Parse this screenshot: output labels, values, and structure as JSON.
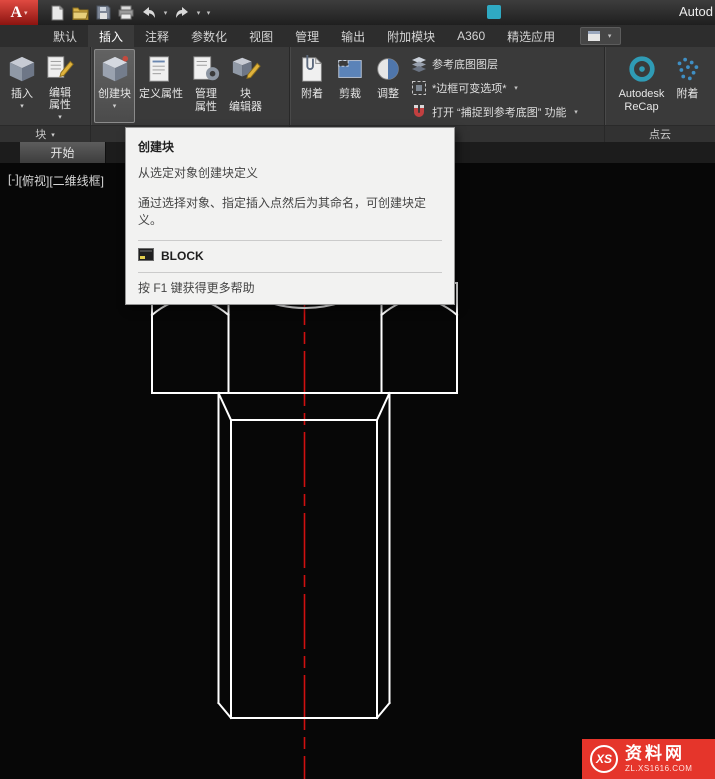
{
  "icons": {
    "caret_down": "▾"
  },
  "titlebar": {
    "logo_letter": "A",
    "window_title": "Autod"
  },
  "tab_bar": {
    "tabs": [
      {
        "label": "默认"
      },
      {
        "label": "插入"
      },
      {
        "label": "注释"
      },
      {
        "label": "参数化"
      },
      {
        "label": "视图"
      },
      {
        "label": "管理"
      },
      {
        "label": "输出"
      },
      {
        "label": "附加模块"
      },
      {
        "label": "A360"
      },
      {
        "label": "精选应用"
      }
    ]
  },
  "ribbon": {
    "block_panel": {
      "label": "块",
      "insert": "插入",
      "edit_attributes": "编辑\n属性"
    },
    "blockdef_panel": {
      "create_block": "创建块",
      "define_attributes": "定义属性",
      "manage_attributes": "管理\n属性",
      "block_editor": "块\n编辑器"
    },
    "reference_panel": {
      "attach": "附着",
      "clip": "剪裁",
      "adjust": "调整",
      "underlay_layers": "参考底图图层",
      "frame_options": "*边框可变选项*",
      "snap_option": "打开 “捕捉到参考底图” 功能"
    },
    "pointcloud_panel": {
      "label": "点云",
      "recap": "Autodesk\nReCap",
      "attach": "附着"
    }
  },
  "file_tab": {
    "label": "开始"
  },
  "tooltip": {
    "title": "创建块",
    "summary": "从选定对象创建块定义",
    "description": "通过选择对象、指定插入点然后为其命名，可创建块定义。",
    "command": "BLOCK",
    "help": "按 F1 键获得更多帮助"
  },
  "viewport": {
    "controls": [
      {
        "label": "[-]"
      },
      {
        "label": "[俯视]"
      },
      {
        "label": "[二维线框]"
      }
    ]
  },
  "watermark": {
    "logo": "XS",
    "site_name": "资料网",
    "site_url": "ZL.XS1616.COM"
  },
  "colors": {
    "centerline_red": "#d01010",
    "drawing_white": "#ffffff"
  }
}
